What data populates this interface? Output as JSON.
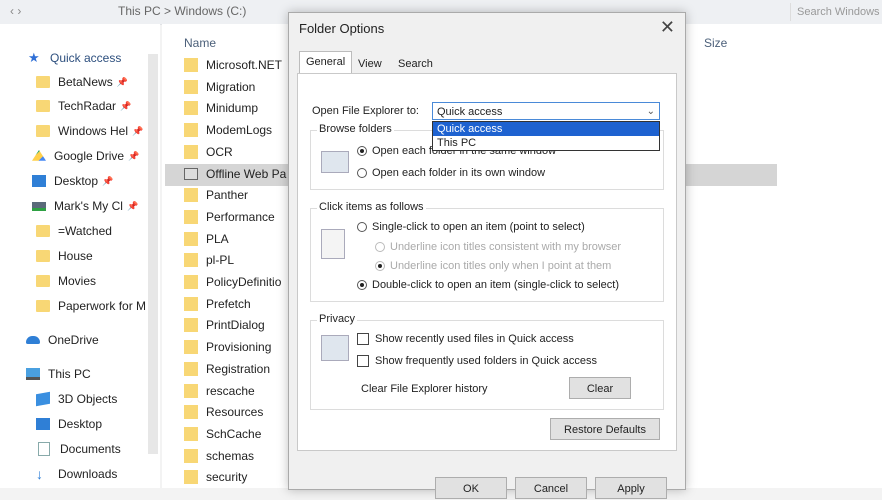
{
  "explorer": {
    "header_col_name": "Name",
    "header_col_size": "Size",
    "address_path": "This PC > Windows (C:)",
    "search_placeholder": "Search Windows",
    "nav_items": [
      {
        "label": "Quick access",
        "icon": "star-icon"
      },
      {
        "label": "BetaNews",
        "icon": "folder-icon"
      },
      {
        "label": "TechRadar",
        "icon": "folder-icon"
      },
      {
        "label": "Windows Hel",
        "icon": "folder-icon"
      },
      {
        "label": "Google Drive",
        "icon": "google-drive-icon"
      },
      {
        "label": "Desktop",
        "icon": "desktop-icon"
      },
      {
        "label": "Mark's My Cl",
        "icon": "network-drive-icon"
      },
      {
        "label": "=Watched",
        "icon": "folder-icon"
      },
      {
        "label": "House",
        "icon": "folder-icon"
      },
      {
        "label": "Movies",
        "icon": "folder-icon"
      },
      {
        "label": "Paperwork for M",
        "icon": "folder-icon"
      },
      {
        "label": "OneDrive",
        "icon": "cloud-icon"
      },
      {
        "label": "This PC",
        "icon": "computer-icon"
      },
      {
        "label": "3D Objects",
        "icon": "cube-icon"
      },
      {
        "label": "Desktop",
        "icon": "desktop-icon"
      },
      {
        "label": "Documents",
        "icon": "document-icon"
      },
      {
        "label": "Downloads",
        "icon": "download-icon"
      }
    ],
    "files": [
      "Microsoft.NET",
      "Migration",
      "Minidump",
      "ModemLogs",
      "OCR",
      "Offline Web Pa",
      "Panther",
      "Performance",
      "PLA",
      "pl-PL",
      "PolicyDefinitio",
      "Prefetch",
      "PrintDialog",
      "Provisioning",
      "Registration",
      "rescache",
      "Resources",
      "SchCache",
      "schemas",
      "security"
    ]
  },
  "dialog": {
    "title": "Folder Options",
    "close_glyph": "✕",
    "tabs": [
      "General",
      "View",
      "Search"
    ],
    "open_explorer_label": "Open File Explorer to:",
    "combo_value": "Quick access",
    "combo_arrow": "⌄",
    "dropdown_options": [
      "Quick access",
      "This PC"
    ],
    "browse_folders_title": "Browse folders",
    "browse_same_window": "Open each folder in the same window",
    "browse_own_window": "Open each folder in its own window",
    "click_items_title": "Click items as follows",
    "single_click": "Single-click to open an item (point to select)",
    "underline_browser": "Underline icon titles consistent with my browser",
    "underline_point": "Underline icon titles only when I point at them",
    "double_click": "Double-click to open an item (single-click to select)",
    "privacy_title": "Privacy",
    "show_recent_files": "Show recently used files in Quick access",
    "show_frequent_folders": "Show frequently used folders in Quick access",
    "clear_history_label": "Clear File Explorer history",
    "clear_button": "Clear",
    "restore_button": "Restore Defaults",
    "ok_button": "OK",
    "cancel_button": "Cancel",
    "apply_button": "Apply"
  },
  "colors": {
    "folder": "#f8d775",
    "accent": "#1e62d0",
    "selection_strip": "#d5d5d5"
  }
}
